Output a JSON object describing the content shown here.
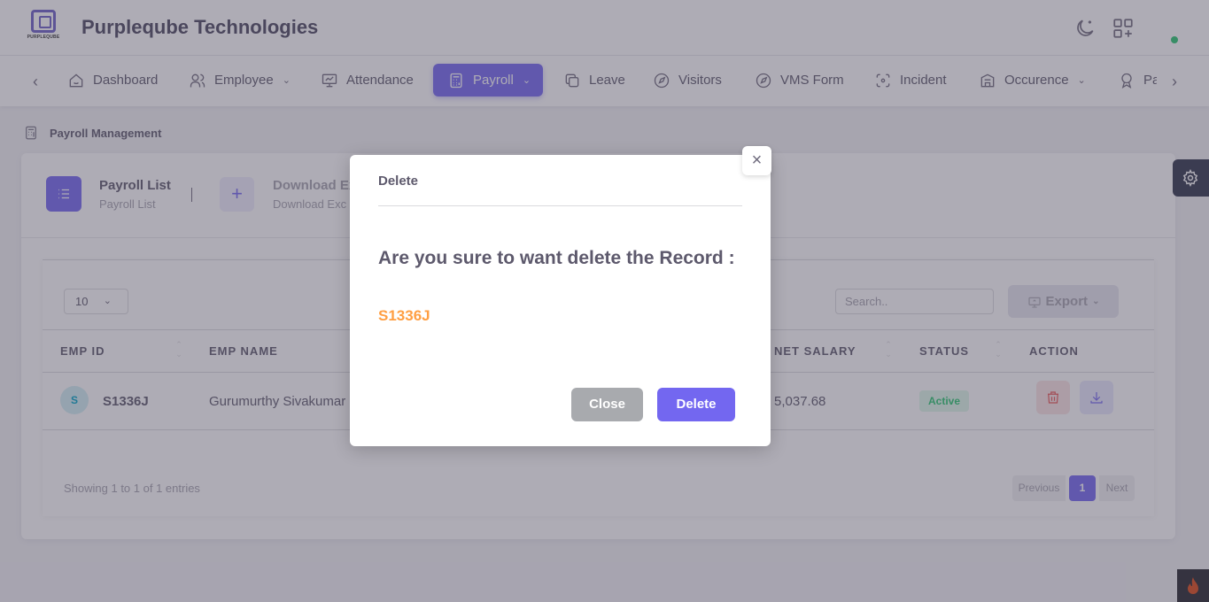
{
  "header": {
    "logo_text": "PURPLEQUBE",
    "company": "Purpleqube Technologies"
  },
  "nav": {
    "items": [
      {
        "label": "Dashboard"
      },
      {
        "label": "Employee"
      },
      {
        "label": "Attendance"
      },
      {
        "label": "Payroll"
      },
      {
        "label": "Leave"
      },
      {
        "label": "Visitors"
      },
      {
        "label": "VMS Form"
      },
      {
        "label": "Incident"
      },
      {
        "label": "Occurence"
      },
      {
        "label": "Pa"
      }
    ]
  },
  "breadcrumb": {
    "label": "Payroll Management"
  },
  "tabs": {
    "list_title": "Payroll List",
    "list_sub": "Payroll List",
    "download_title": "Download Ex",
    "download_sub": "Download Exc"
  },
  "table_controls": {
    "page_length": "10",
    "search_placeholder": "Search..",
    "export_label": "Export"
  },
  "table": {
    "headers": [
      "EMP ID",
      "EMP NAME",
      "NET SALARY",
      "STATUS",
      "ACTION"
    ],
    "rows": [
      {
        "avatar": "S",
        "emp_id": "S1336J",
        "emp_name": "Gurumurthy Sivakumar",
        "net_salary": "5,037.68",
        "status": "Active"
      }
    ]
  },
  "footer": {
    "info": "Showing 1 to 1 of 1 entries",
    "prev": "Previous",
    "page": "1",
    "next": "Next"
  },
  "modal": {
    "title": "Delete",
    "close_x": "×",
    "question": "Are you sure to want delete the Record :",
    "record_id": "S1336J",
    "close_label": "Close",
    "delete_label": "Delete"
  },
  "colors": {
    "accent": "#7367f0",
    "record_highlight": "#ff9f43",
    "status_active": "#28c76f",
    "danger": "#ea5455"
  }
}
